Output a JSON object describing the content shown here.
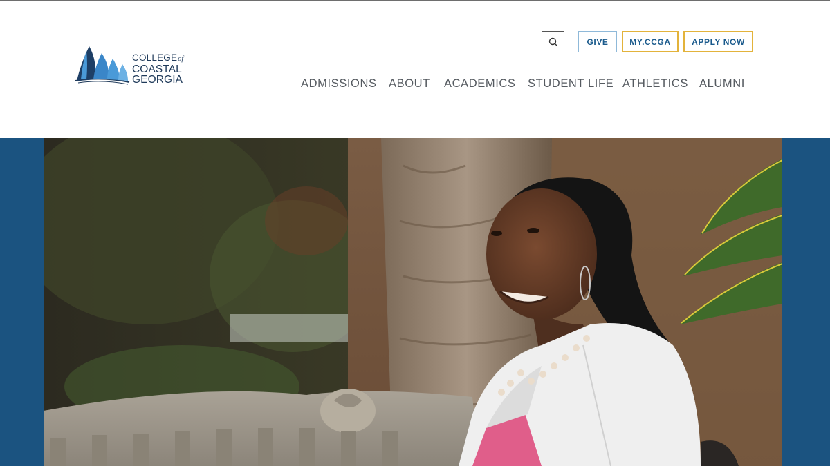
{
  "logo": {
    "line1": "COLLEGE",
    "line1_suffix": "of",
    "line2": "COASTAL",
    "line3": "GEORGIA",
    "icon": "sailing-ship-icon"
  },
  "utility": {
    "search_icon": "search-icon",
    "give": "GIVE",
    "myccga": "MY.CCGA",
    "apply": "APPLY NOW"
  },
  "nav": [
    {
      "label": "ADMISSIONS"
    },
    {
      "label": "ABOUT"
    },
    {
      "label": "ACADEMICS"
    },
    {
      "label": "STUDENT LIFE"
    },
    {
      "label": "ATHLETICS"
    },
    {
      "label": "ALUMNI"
    }
  ],
  "colors": {
    "brand_blue": "#1b5380",
    "accent_gold": "#e3b33b",
    "light_blue_border": "#8fb9d9",
    "nav_text": "#555a60"
  }
}
